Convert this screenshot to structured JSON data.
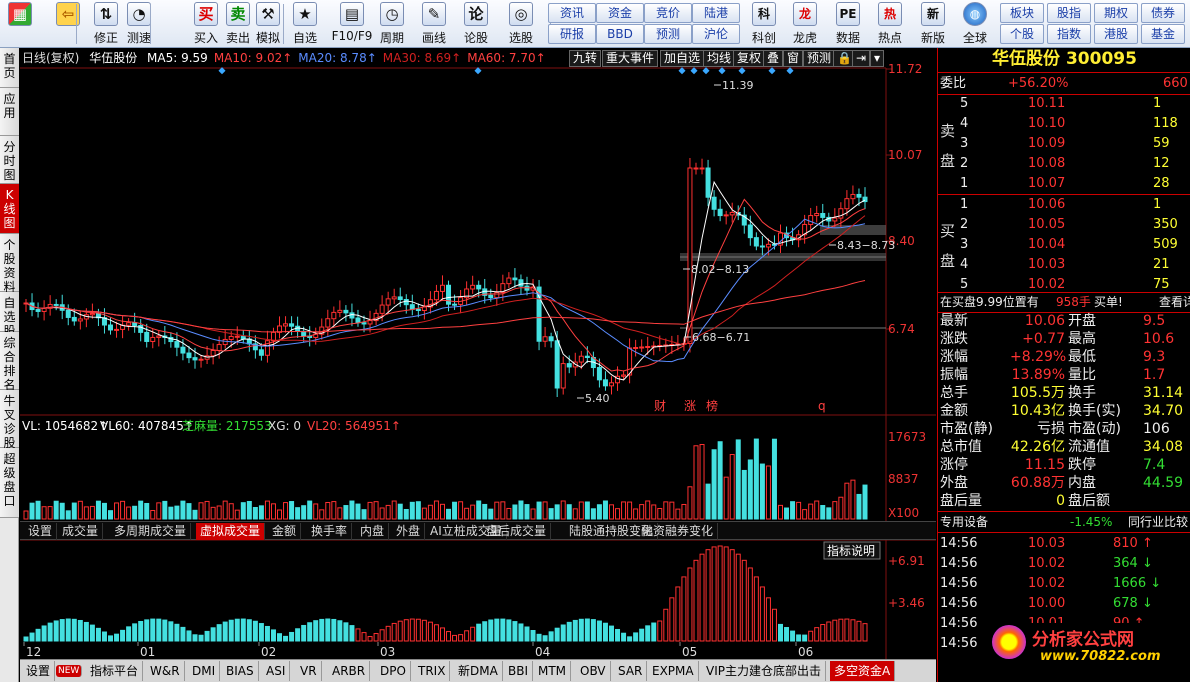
{
  "toolbar": {
    "left": [
      {
        "label": "",
        "icon": "windows-logo-icon",
        "glyph": "▦"
      },
      {
        "label": "",
        "icon": "back-arrow-icon",
        "glyph": "⇦"
      },
      {
        "label": "修正",
        "icon": "up-down-arrows-icon",
        "glyph": "⇅"
      },
      {
        "label": "测速",
        "icon": "speed-test-icon",
        "glyph": "◔"
      },
      {
        "label": "买入",
        "icon": "buy-icon",
        "glyph": "买"
      },
      {
        "label": "卖出",
        "icon": "sell-icon",
        "glyph": "卖"
      },
      {
        "label": "模拟",
        "icon": "hammer-icon",
        "glyph": "⚒"
      },
      {
        "label": "自选",
        "icon": "favorites-icon",
        "glyph": "★"
      },
      {
        "label": "F10/F9",
        "icon": "f10-icon",
        "glyph": "▤"
      },
      {
        "label": "周期",
        "icon": "period-clock-icon",
        "glyph": "◷"
      },
      {
        "label": "画线",
        "icon": "pencil-icon",
        "glyph": "✎"
      },
      {
        "label": "论股",
        "icon": "forum-icon",
        "glyph": "论"
      },
      {
        "label": "选股",
        "icon": "stock-picker-icon",
        "glyph": "◎"
      }
    ],
    "grid": [
      "资讯",
      "资金",
      "竞价",
      "陆港",
      "研报",
      "BBD",
      "预测",
      "沪伦"
    ],
    "right": [
      {
        "label": "科创",
        "icon": "star-market-icon",
        "glyph": "科"
      },
      {
        "label": "龙虎",
        "icon": "dragon-tiger-icon",
        "glyph": "龙"
      },
      {
        "label": "数据",
        "icon": "pe-data-icon",
        "glyph": "PE"
      },
      {
        "label": "热点",
        "icon": "hotspot-icon",
        "glyph": "热"
      },
      {
        "label": "新版",
        "icon": "new-version-icon",
        "glyph": "新"
      },
      {
        "label": "全球",
        "icon": "globe-icon",
        "glyph": "◍"
      }
    ],
    "grid2": [
      "板块",
      "股指",
      "期权",
      "债券",
      "个股",
      "指数",
      "港股",
      "基金"
    ]
  },
  "left_tabs": [
    "首页",
    "应用",
    "分时图",
    "K线图",
    "个股资料",
    "自选股",
    "综合排名",
    "牛叉诊股",
    "超级盘口"
  ],
  "chart_header": {
    "period": "日线(复权)",
    "name": "华伍股份",
    "ma": [
      {
        "text": "MA5: 9.59",
        "color": "#ffffff"
      },
      {
        "text": "MA10: 9.02↑",
        "color": "#ff4040"
      },
      {
        "text": "MA20: 8.78↑",
        "color": "#5a8cff"
      },
      {
        "text": "MA30: 8.69↑",
        "color": "#d02020"
      },
      {
        "text": "MA60: 7.70↑",
        "color": "#ff4040"
      }
    ],
    "tools": [
      "九转",
      "重大事件",
      "加自选",
      "均线",
      "复权",
      "叠",
      "窗",
      "预测",
      "🔒",
      "⇥",
      "▾"
    ]
  },
  "price_axis": [
    "11.72",
    "10.07",
    "8.40",
    "6.74"
  ],
  "annotations": [
    "11.39",
    "8.02−8.13",
    "8.43−8.73",
    "6.68−6.71",
    "5.40"
  ],
  "event_marks": [
    "财",
    "涨",
    "榜",
    "q"
  ],
  "volume_header": {
    "vl": "VL: 1054682↑",
    "vl60": "VL60: 407845↑",
    "zm": "芝麻量: 217553",
    "xg": "XG: 0",
    "vl20": "VL20: 564951↑"
  },
  "volume_axis": [
    "17673",
    "8837",
    "X100"
  ],
  "sub_tabs": [
    "设置",
    "成交量",
    "多周期成交量",
    "虚拟成交量",
    "金额",
    "换手率",
    "内盘",
    "外盘",
    "AI立桩成交量",
    "盘后成交量",
    "陆股通持股变化",
    "融资融券变化"
  ],
  "indicator_button": "指标说明",
  "indicator_axis": [
    "+6.91",
    "+3.46"
  ],
  "month_labels": [
    "12",
    "01",
    "02",
    "03",
    "04",
    "05",
    "06"
  ],
  "bottom_tabs": [
    "设置",
    "NEW",
    "指标平台",
    "W&R",
    "DMI",
    "BIAS",
    "ASI",
    "VR",
    "ARBR",
    "DPO",
    "TRIX",
    "新DMA",
    "BBI",
    "MTM",
    "OBV",
    "SAR",
    "EXPMA",
    "VIP主力建仓底部出击",
    "多空资金A"
  ],
  "quote": {
    "title": "华伍股份 300095",
    "weibi": {
      "label": "委比",
      "value": "+56.20%",
      "extra": "660"
    },
    "sell": [
      {
        "level": "5",
        "price": "10.11",
        "vol": "1"
      },
      {
        "level": "4",
        "price": "10.10",
        "vol": "118"
      },
      {
        "level": "3",
        "price": "10.09",
        "vol": "59"
      },
      {
        "level": "2",
        "price": "10.08",
        "vol": "12"
      },
      {
        "level": "1",
        "price": "10.07",
        "vol": "28"
      }
    ],
    "sell_label": [
      "卖",
      "盘"
    ],
    "buy": [
      {
        "level": "1",
        "price": "10.06",
        "vol": "1"
      },
      {
        "level": "2",
        "price": "10.05",
        "vol": "350"
      },
      {
        "level": "3",
        "price": "10.04",
        "vol": "509"
      },
      {
        "level": "4",
        "price": "10.03",
        "vol": "21"
      },
      {
        "level": "5",
        "price": "10.02",
        "vol": "75"
      }
    ],
    "buy_label": [
      "买",
      "盘"
    ],
    "order_note": {
      "a": "在买盘9.99位置有",
      "b": "958手",
      "c": "买单!",
      "d": "查看详"
    },
    "stats": [
      {
        "l1": "最新",
        "v1": "10.06",
        "c1": "red",
        "l2": "开盘",
        "v2": "9.5",
        "c2": "red"
      },
      {
        "l1": "涨跌",
        "v1": "+0.77",
        "c1": "red",
        "l2": "最高",
        "v2": "10.6",
        "c2": "red"
      },
      {
        "l1": "涨幅",
        "v1": "+8.29%",
        "c1": "red",
        "l2": "最低",
        "v2": "9.3",
        "c2": "red"
      },
      {
        "l1": "振幅",
        "v1": "13.89%",
        "c1": "red",
        "l2": "量比",
        "v2": "1.7",
        "c2": "red"
      },
      {
        "l1": "总手",
        "v1": "105.5万",
        "c1": "yellow",
        "l2": "换手",
        "v2": "31.14",
        "c2": "yellow"
      },
      {
        "l1": "金额",
        "v1": "10.43亿",
        "c1": "yellow",
        "l2": "换手(实)",
        "v2": "34.70",
        "c2": "yellow"
      },
      {
        "l1": "市盈(静)",
        "v1": "亏损",
        "c1": "white",
        "l2": "市盈(动)",
        "v2": "106",
        "c2": "white"
      },
      {
        "l1": "总市值",
        "v1": "42.26亿",
        "c1": "yellow",
        "l2": "流通值",
        "v2": "34.08",
        "c2": "yellow"
      },
      {
        "l1": "涨停",
        "v1": "11.15",
        "c1": "red",
        "l2": "跌停",
        "v2": "7.4",
        "c2": "green"
      },
      {
        "l1": "外盘",
        "v1": "60.88万",
        "c1": "red",
        "l2": "内盘",
        "v2": "44.59",
        "c2": "green"
      },
      {
        "l1": "盘后量",
        "v1": "0",
        "c1": "yellow",
        "l2": "盘后额",
        "v2": "",
        "c2": "yellow"
      }
    ],
    "industry": {
      "label": "专用设备",
      "value": "-1.45%",
      "rank": "同行业比较"
    },
    "ticks": [
      {
        "t": "14:56",
        "p": "10.03",
        "v": "810",
        "dir": "up"
      },
      {
        "t": "14:56",
        "p": "10.02",
        "v": "364",
        "dir": "down"
      },
      {
        "t": "14:56",
        "p": "10.02",
        "v": "1666",
        "dir": "down"
      },
      {
        "t": "14:56",
        "p": "10.00",
        "v": "678",
        "dir": "down"
      },
      {
        "t": "14:56",
        "p": "10.01",
        "v": "90",
        "dir": "up"
      },
      {
        "t": "14:56",
        "p": "",
        "v": "",
        "dir": ""
      }
    ],
    "watermark": {
      "text": "分析家公式网",
      "url": "www.70822.com"
    }
  },
  "colors": {
    "up": "#ff3030",
    "down": "#44e0e0",
    "ma5": "#ffffff",
    "ma10": "#ff4040",
    "ma20": "#5a8cff",
    "ma30": "#d02020",
    "ma60": "#ff4040",
    "accent": "#cc0000"
  }
}
